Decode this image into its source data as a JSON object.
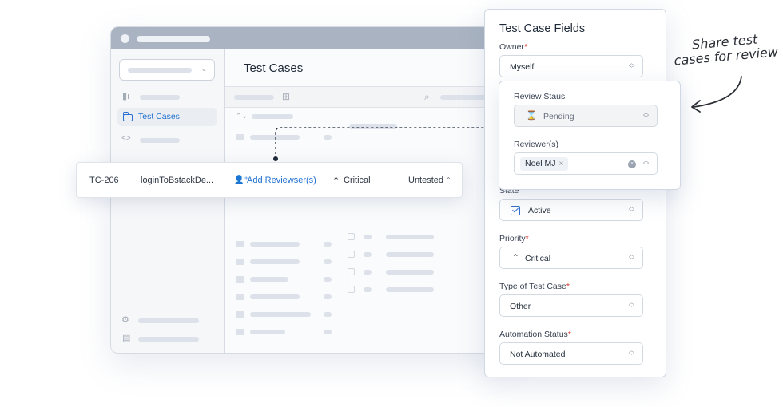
{
  "annotation": {
    "line1": "Share test",
    "line2": "cases for review"
  },
  "app": {
    "sidebar": {
      "active_item": "Test Cases"
    },
    "main": {
      "title": "Test Cases"
    }
  },
  "test_case_row": {
    "id": "TC-206",
    "name": "loginToBstackDe...",
    "add_reviewers": "Add Reviewser(s)",
    "priority": "Critical",
    "status": "Untested"
  },
  "fields_panel": {
    "title": "Test Case Fields",
    "owner": {
      "label": "Owner",
      "value": "Myself"
    },
    "state": {
      "label": "State",
      "value": "Active"
    },
    "priority": {
      "label": "Priority",
      "value": "Critical"
    },
    "type": {
      "label": "Type of Test Case",
      "value": "Other"
    },
    "automation": {
      "label": "Automation Status",
      "value": "Not Automated"
    }
  },
  "review_popover": {
    "status_label": "Review Staus",
    "status_value": "Pending",
    "reviewers_label": "Reviewer(s)",
    "reviewer_chip": "Noel MJ"
  },
  "colors": {
    "accent": "#1f6fce",
    "critical": "#d9342b",
    "required": "#d9342b",
    "titlebar": "#a9b3c1"
  }
}
